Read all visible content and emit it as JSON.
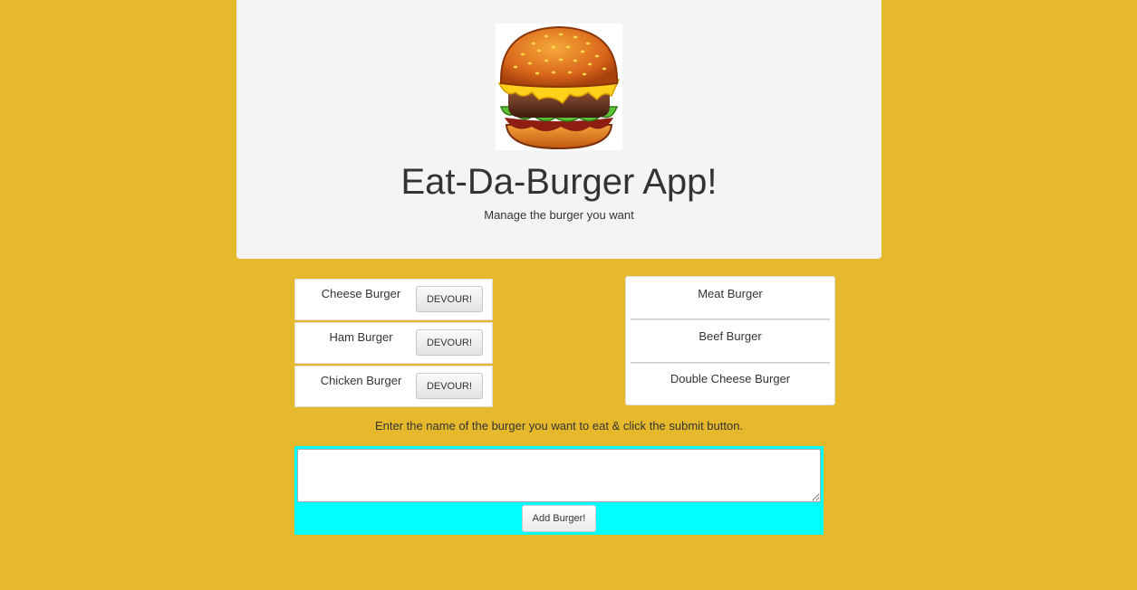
{
  "header": {
    "logo_icon": "burger-icon",
    "title": "Eat-Da-Burger App!",
    "subtitle": "Manage the burger you want"
  },
  "uneaten_burgers": [
    {
      "name": "Cheese Burger",
      "button_label": "DEVOUR!"
    },
    {
      "name": "Ham Burger",
      "button_label": "DEVOUR!"
    },
    {
      "name": "Chicken Burger",
      "button_label": "DEVOUR!"
    }
  ],
  "devoured_burgers": [
    {
      "name": "Meat Burger"
    },
    {
      "name": "Beef Burger"
    },
    {
      "name": "Double Cheese Burger"
    }
  ],
  "form": {
    "instructions": "Enter the name of the burger you want to eat & click the submit button.",
    "input_value": "",
    "submit_label": "Add Burger!"
  },
  "colors": {
    "page_background": "#e6b92c",
    "jumbotron_background": "#f4f4f4",
    "form_background": "#00ffff"
  }
}
